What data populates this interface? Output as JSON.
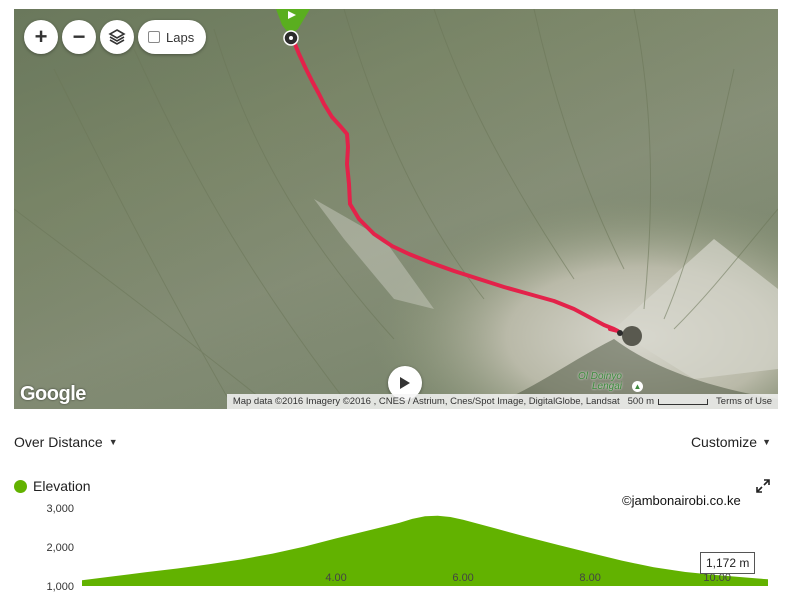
{
  "map": {
    "controls": {
      "zoom_in": "+",
      "zoom_out": "−",
      "layers_icon": "layers-icon",
      "laps_label": "Laps"
    },
    "google_logo": "Google",
    "attribution": "Map data ©2016 Imagery ©2016 , CNES / Astrium, Cnes/Spot Image, DigitalGlobe, Landsat",
    "scale_label": "500 m",
    "terms": "Terms of Use",
    "place_label_line1": "Ol Doinyo",
    "place_label_line2": "Lengai",
    "route_color": "#e3224a",
    "start_marker_color": "#5aae1f"
  },
  "chart_header": {
    "mode_label": "Over Distance",
    "customize_label": "Customize",
    "legend_label": "Elevation",
    "legend_color": "#62b200",
    "watermark": "©jambonairobi.co.ke",
    "tooltip": "1,172 m"
  },
  "chart_data": {
    "type": "area",
    "series": [
      {
        "name": "Elevation",
        "x": [
          0,
          0.5,
          1,
          1.5,
          2,
          2.5,
          3,
          3.5,
          4,
          4.5,
          5,
          5.2,
          5.4,
          5.6,
          5.8,
          6,
          6.5,
          7,
          7.5,
          8,
          8.5,
          9,
          9.5,
          10,
          10.5,
          10.8
        ],
        "values": [
          1150,
          1250,
          1350,
          1450,
          1560,
          1680,
          1830,
          2010,
          2220,
          2420,
          2620,
          2720,
          2790,
          2800,
          2770,
          2700,
          2480,
          2260,
          2050,
          1850,
          1650,
          1480,
          1360,
          1280,
          1210,
          1172
        ]
      }
    ],
    "y_ticks": [
      "3,000",
      "2,000",
      "1,000"
    ],
    "x_ticks": [
      "4.00",
      "6.00",
      "8.00",
      "10.00"
    ],
    "ylim": [
      1000,
      3000
    ],
    "xlim": [
      0,
      10.8
    ],
    "grid": false
  }
}
